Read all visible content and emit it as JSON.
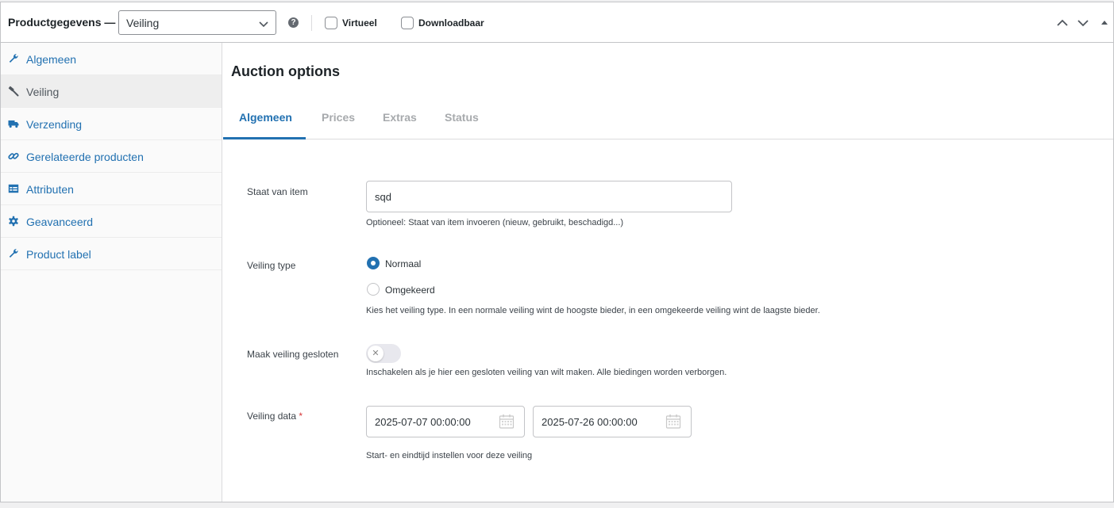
{
  "header": {
    "title": "Productgegevens —",
    "product_type": "Veiling",
    "help": "?",
    "virtual_label": "Virtueel",
    "downloadable_label": "Downloadbaar"
  },
  "sidebar": {
    "items": [
      {
        "label": "Algemeen",
        "icon": "wrench-icon"
      },
      {
        "label": "Veiling",
        "icon": "gavel-icon",
        "active": true
      },
      {
        "label": "Verzending",
        "icon": "truck-icon"
      },
      {
        "label": "Gerelateerde producten",
        "icon": "link-icon"
      },
      {
        "label": "Attributen",
        "icon": "table-icon"
      },
      {
        "label": "Geavanceerd",
        "icon": "gear-icon"
      },
      {
        "label": "Product label",
        "icon": "wrench-icon"
      }
    ]
  },
  "main": {
    "heading": "Auction options",
    "tabs": [
      {
        "label": "Algemeen",
        "active": true
      },
      {
        "label": "Prices"
      },
      {
        "label": "Extras"
      },
      {
        "label": "Status"
      }
    ],
    "fields": {
      "condition": {
        "label": "Staat van item",
        "value": "sqd",
        "description": "Optioneel: Staat van item invoeren (nieuw, gebruikt, beschadigd...)"
      },
      "type": {
        "label": "Veiling type",
        "options": [
          "Normaal",
          "Omgekeerd"
        ],
        "selected": "Normaal",
        "description": "Kies het veiling type. In een normale veiling wint de hoogste bieder, in een omgekeerde veiling wint de laagste bieder."
      },
      "sealed": {
        "label": "Maak veiling gesloten",
        "enabled": false,
        "knob_glyph": "✕",
        "description": "Inschakelen als je hier een gesloten veiling van wilt maken. Alle biedingen worden verborgen."
      },
      "dates": {
        "label": "Veiling data",
        "required_mark": "*",
        "start": "2025-07-07 00:00:00",
        "end": "2025-07-26 00:00:00",
        "description": "Start- en eindtijd instellen voor deze veiling"
      }
    }
  },
  "colors": {
    "accent": "#2271b1",
    "required": "#d63638",
    "muted_tab": "#a7aaad"
  }
}
